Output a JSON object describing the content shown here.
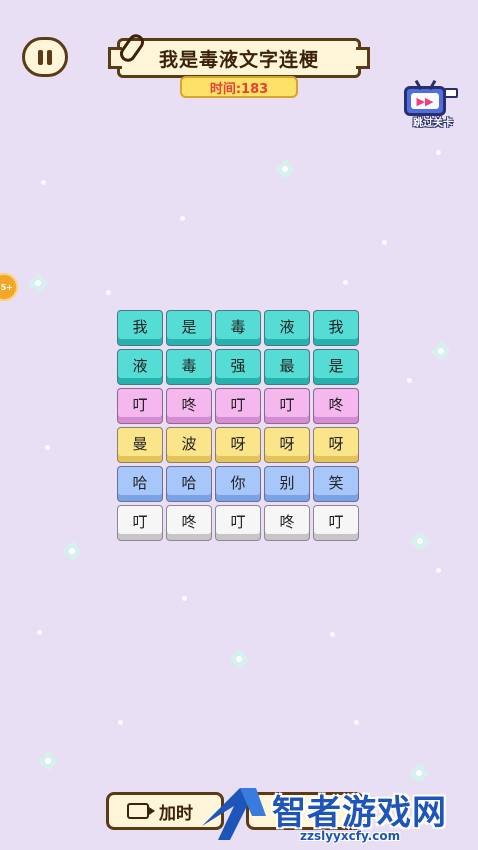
{
  "header": {
    "title": "我是毒液文字连梗",
    "timer": "时间:183",
    "skip_label": "跳过关卡",
    "coin_badge": "5+"
  },
  "board": {
    "rows": [
      {
        "color": "teal",
        "chars": [
          "我",
          "是",
          "毒",
          "液",
          "我"
        ]
      },
      {
        "color": "teal",
        "chars": [
          "液",
          "毒",
          "强",
          "最",
          "是"
        ]
      },
      {
        "color": "pink",
        "chars": [
          "叮",
          "咚",
          "叮",
          "叮",
          "咚"
        ]
      },
      {
        "color": "yellow",
        "chars": [
          "曼",
          "波",
          "呀",
          "呀",
          "呀"
        ]
      },
      {
        "color": "blue",
        "chars": [
          "哈",
          "哈",
          "你",
          "别",
          "笑"
        ]
      },
      {
        "color": "white",
        "chars": [
          "叮",
          "咚",
          "叮",
          "咚",
          "叮"
        ]
      }
    ]
  },
  "footer": {
    "add_time_label": "加时",
    "hint_label": "提示"
  },
  "watermark": {
    "name": "智者游戏网",
    "url": "zzslyyxcfy.com"
  },
  "colors": {
    "background": "#e9dff4",
    "teal": "#55dcd4",
    "pink": "#f4b8ef",
    "yellow": "#fbe58a",
    "blue": "#a7c7fa",
    "white": "#f6f6f6",
    "timer_text": "#e2423a",
    "watermark": "#1d55b8"
  }
}
